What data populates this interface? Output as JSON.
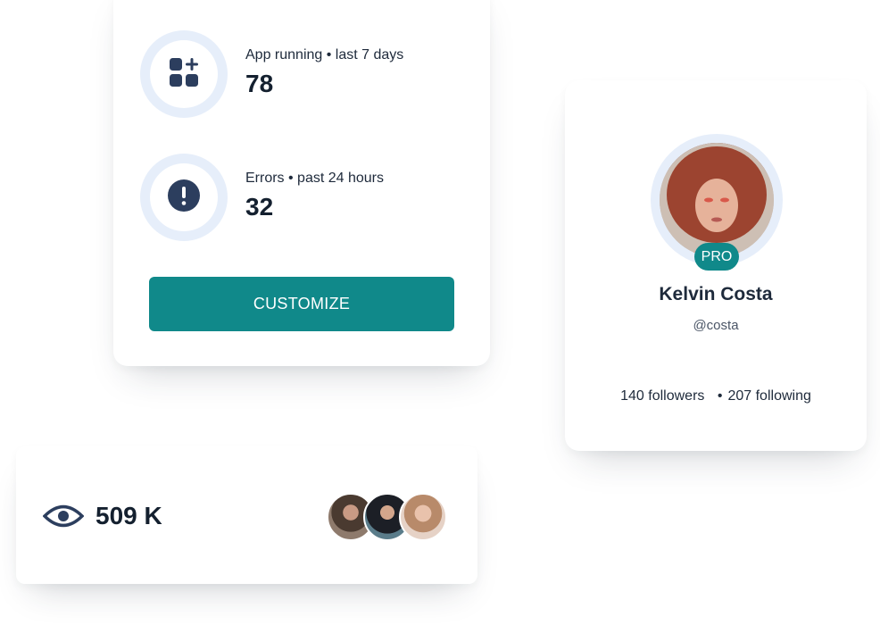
{
  "stats": [
    {
      "label": "App running • last 7 days",
      "value": "78",
      "icon": "apps-add-icon"
    },
    {
      "label": "Errors • past 24 hours",
      "value": "32",
      "icon": "error-alert-icon"
    }
  ],
  "actions": {
    "customize_label": "CUSTOMIZE"
  },
  "profile": {
    "badge": "PRO",
    "name": "Kelvin Costa",
    "handle": "@costa",
    "followers": "140 followers",
    "following": "207 following",
    "separator": "•"
  },
  "views": {
    "value": "509 K",
    "icon": "eye-icon"
  },
  "colors": {
    "accent": "#10898a",
    "ring": "#e6eefa",
    "icon": "#2c3e5e",
    "text": "#1e2a3b"
  }
}
